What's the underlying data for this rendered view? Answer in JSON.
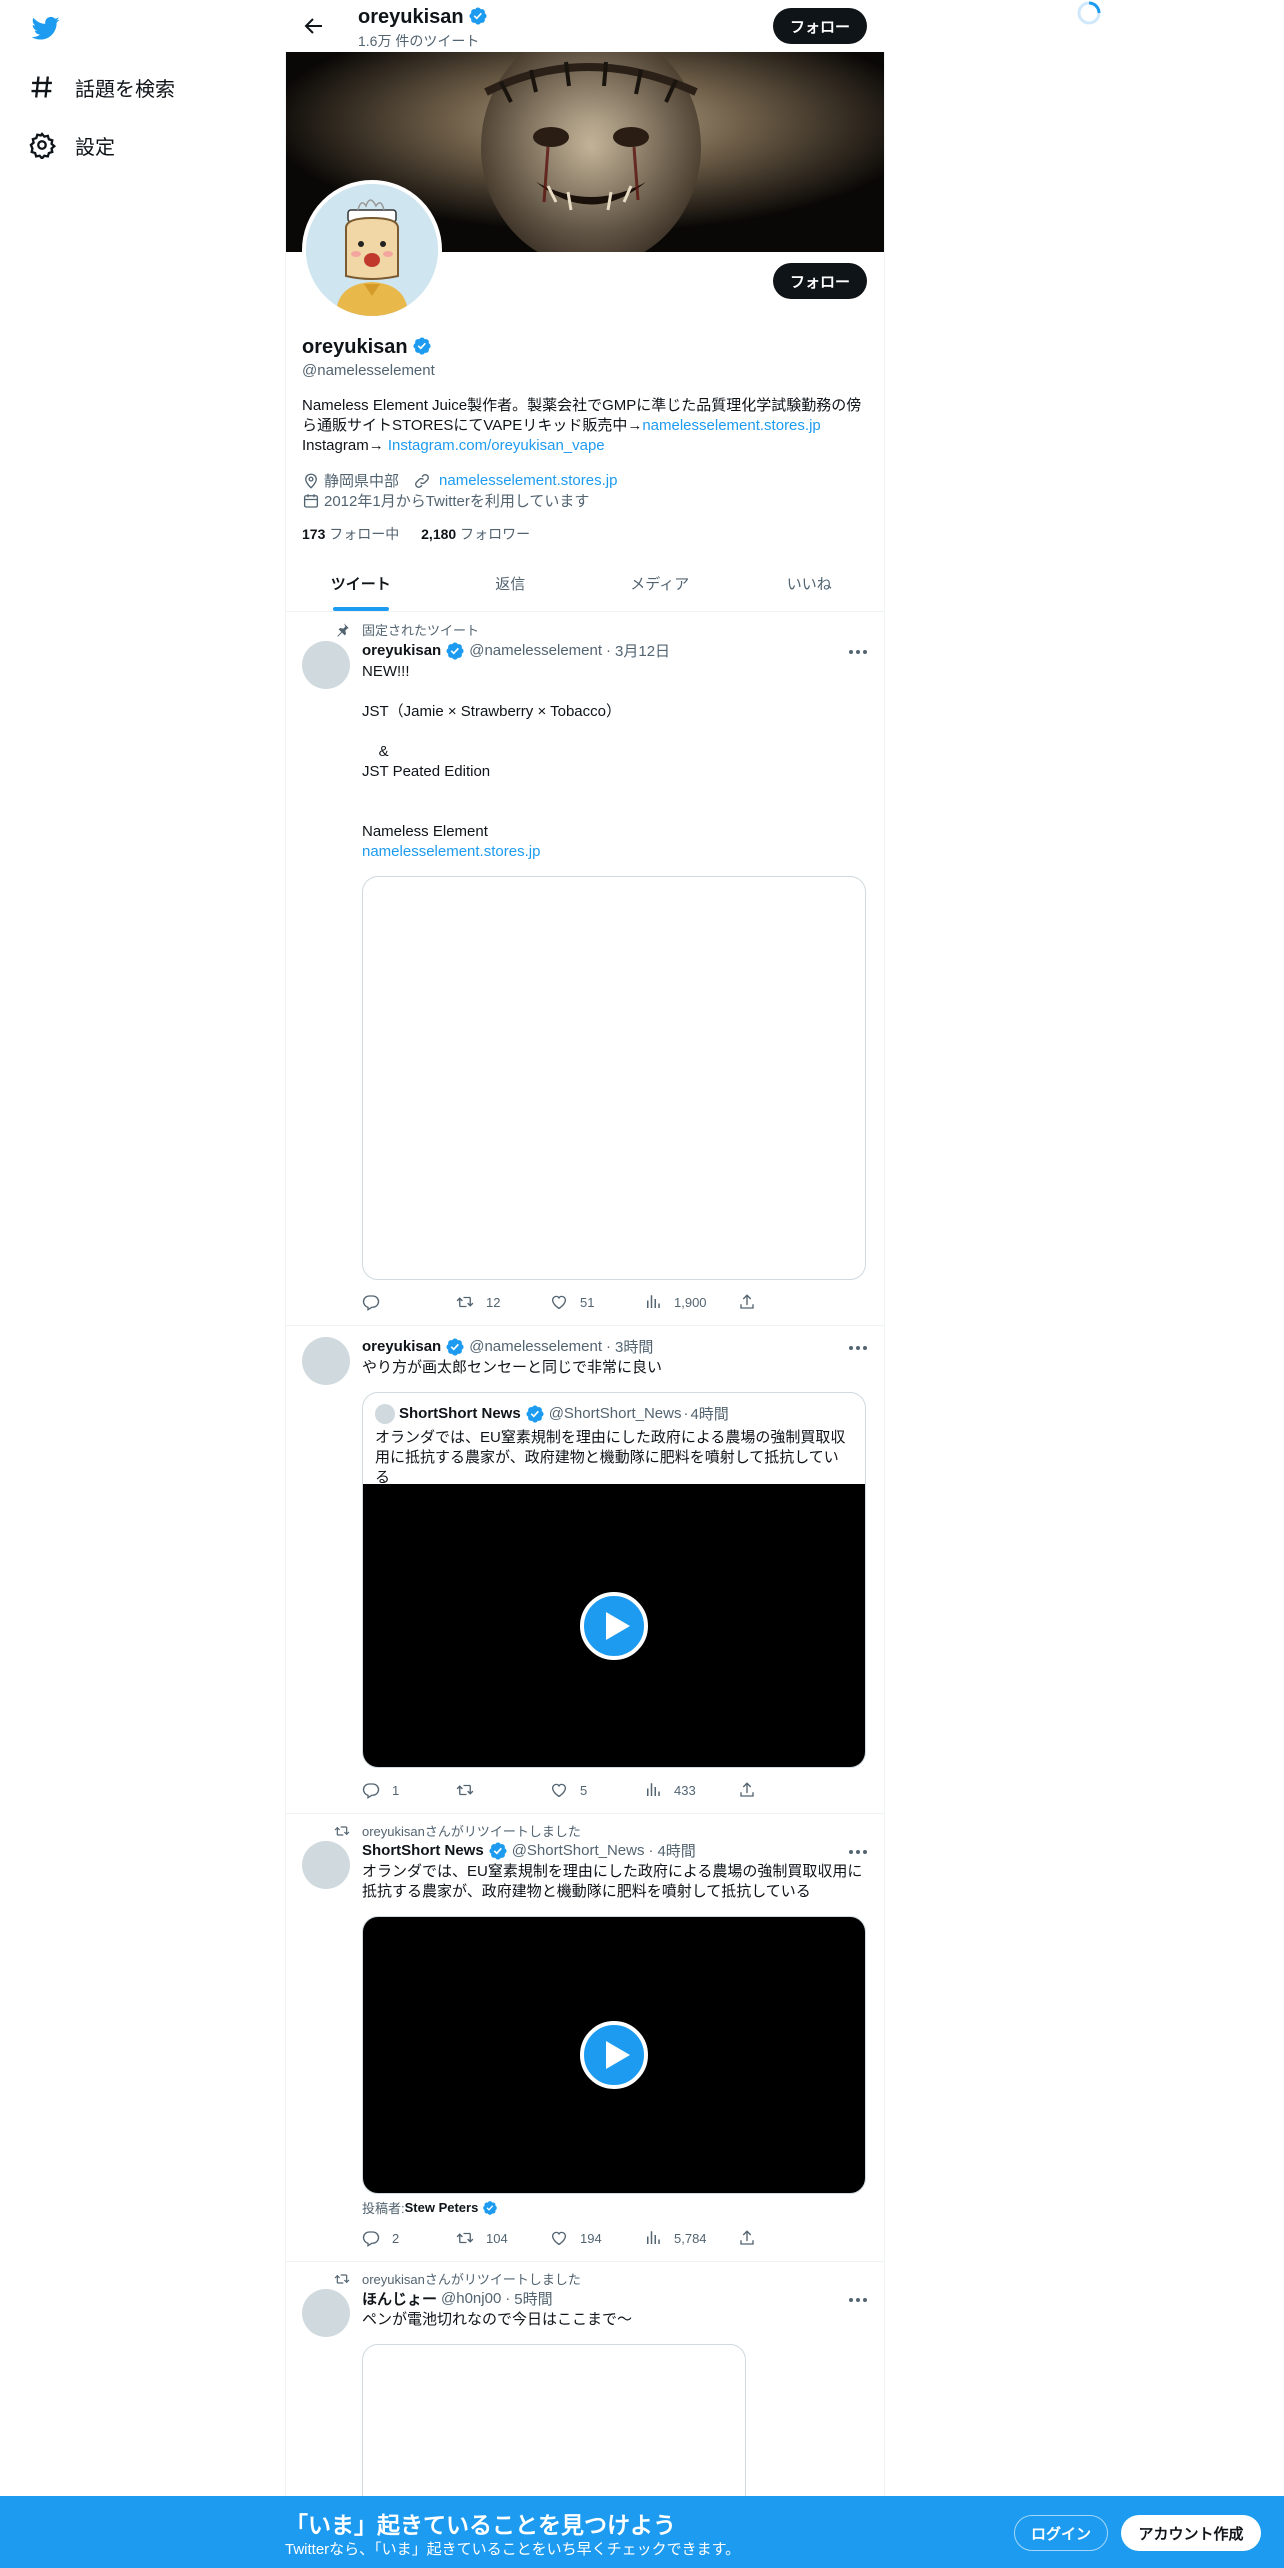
{
  "nav": {
    "explore_label": "話題を検索",
    "settings_label": "設定"
  },
  "header": {
    "name": "oreyukisan",
    "tweet_count": "1.6万 件のツイート",
    "follow_label": "フォロー"
  },
  "profile": {
    "name": "oreyukisan",
    "handle": "@namelesselement",
    "bio_line1": "Nameless Element Juice製作者。製薬会社でGMPに準じた品質理化学試験勤務の傍",
    "bio_line2_text": "ら通販サイトSTORESにてVAPEリキッド販売中→",
    "bio_line2_link": "namelesselement.stores.jp",
    "bio_line3_text": "Instagram→ ",
    "bio_line3_link": "Instagram.com/oreyukisan_vape",
    "location": "静岡県中部",
    "website": "namelesselement.stores.jp",
    "joined": "2012年1月からTwitterを利用しています",
    "following_count": "173",
    "following_label": "フォロー中",
    "followers_count": "2,180",
    "followers_label": "フォロワー",
    "follow_label": "フォロー"
  },
  "tabs": [
    {
      "label": "ツイート",
      "active": true
    },
    {
      "label": "返信"
    },
    {
      "label": "メディア"
    },
    {
      "label": "いいね"
    }
  ],
  "tweets": [
    {
      "context": "固定されたツイート",
      "name": "oreyukisan",
      "handle": "@namelesselement",
      "time": "3月12日",
      "text": "NEW!!!\n\nJST（Jamie × Strawberry × Tobacco）\n\n    &\nJST Peated Edition\n\n\nNameless Element",
      "link": "namelesselement.stores.jp",
      "reply": "",
      "retweet": "12",
      "like": "51",
      "views": "1,900"
    },
    {
      "name": "oreyukisan",
      "handle": "@namelesselement",
      "time": "3時間",
      "text": "やり方が画太郎センセーと同じで非常に良い",
      "quote": {
        "name": "ShortShort News",
        "handle": "@ShortShort_News",
        "time": "4時間",
        "text": "オランダでは、EU窒素規制を理由にした政府による農場の強制買取収用に抵抗する農家が、政府建物と機動隊に肥料を噴射して抵抗している"
      },
      "reply": "1",
      "retweet": "",
      "like": "5",
      "views": "433"
    },
    {
      "context": "oreyukisanさんがリツイートしました",
      "name": "ShortShort News",
      "handle": "@ShortShort_News",
      "time": "4時間",
      "text": "オランダでは、EU窒素規制を理由にした政府による農場の強制買取収用に抵抗する農家が、政府建物と機動隊に肥料を噴射して抵抗している",
      "poster_label": "投稿者: ",
      "poster_name": "Stew Peters",
      "reply": "2",
      "retweet": "104",
      "like": "194",
      "views": "5,784"
    },
    {
      "context": "oreyukisanさんがリツイートしました",
      "name": "ほんじょー",
      "handle": "@h0nj00",
      "time": "5時間",
      "text": "ペンが電池切れなので今日はここまで〜"
    }
  ],
  "bottom_bar": {
    "title": "「いま」起きていることを見つけよう",
    "subtitle": "Twitterなら、「いま」起きていることをいち早くチェックできます。",
    "login_label": "ログイン",
    "signup_label": "アカウント作成"
  },
  "colors": {
    "accent": "#1d9bf0",
    "text": "#0f1419",
    "muted": "#536471"
  }
}
